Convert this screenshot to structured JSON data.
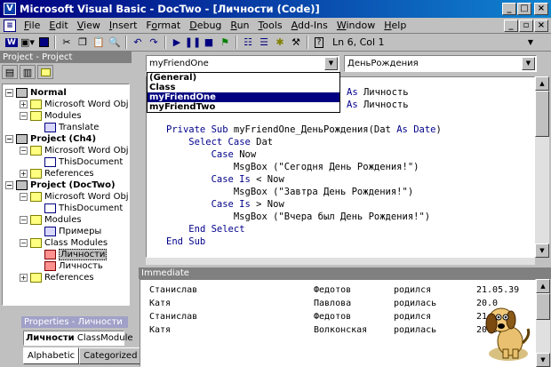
{
  "window": {
    "title": "Microsoft Visual Basic - DocTwo - [Личности (Code)]",
    "app_icon": "vb-icon"
  },
  "menubar": {
    "items": [
      "File",
      "Edit",
      "View",
      "Insert",
      "Format",
      "Debug",
      "Run",
      "Tools",
      "Add-Ins",
      "Window",
      "Help"
    ],
    "accelerators": [
      "F",
      "E",
      "V",
      "I",
      "o",
      "D",
      "R",
      "T",
      "A",
      "W",
      "H"
    ]
  },
  "toolbar": {
    "position": "Ln 6, Col 1",
    "icons": [
      "word-icon",
      "insert-module-icon",
      "save-icon",
      "cut-icon",
      "copy-icon",
      "paste-icon",
      "find-icon",
      "undo-icon",
      "redo-icon",
      "run-icon",
      "break-icon",
      "reset-icon",
      "design-mode-icon",
      "project-explorer-icon",
      "properties-icon",
      "object-browser-icon",
      "toolbox-icon",
      "help-icon"
    ]
  },
  "project_panel": {
    "title": "Project - Project",
    "tree": [
      {
        "label": "Normal",
        "bold": true,
        "level": 0,
        "expander": "−",
        "icon": "project-icon"
      },
      {
        "label": "Microsoft Word Objects",
        "level": 1,
        "expander": "+",
        "icon": "folder-icon"
      },
      {
        "label": "Modules",
        "level": 1,
        "expander": "−",
        "icon": "folder-icon"
      },
      {
        "label": "Translate",
        "level": 2,
        "icon": "module-icon"
      },
      {
        "label": "Project (Ch4)",
        "bold": true,
        "level": 0,
        "expander": "−",
        "icon": "project-icon"
      },
      {
        "label": "Microsoft Word Objects",
        "level": 1,
        "expander": "−",
        "icon": "folder-icon"
      },
      {
        "label": "ThisDocument",
        "level": 2,
        "icon": "document-icon"
      },
      {
        "label": "References",
        "level": 1,
        "expander": "+",
        "icon": "folder-icon"
      },
      {
        "label": "Project (DocTwo)",
        "bold": true,
        "level": 0,
        "expander": "−",
        "icon": "project-icon"
      },
      {
        "label": "Microsoft Word Objects",
        "level": 1,
        "expander": "−",
        "icon": "folder-icon"
      },
      {
        "label": "ThisDocument",
        "level": 2,
        "icon": "document-icon"
      },
      {
        "label": "Modules",
        "level": 1,
        "expander": "−",
        "icon": "folder-icon"
      },
      {
        "label": "Примеры",
        "level": 2,
        "icon": "module-icon"
      },
      {
        "label": "Class Modules",
        "level": 1,
        "expander": "−",
        "icon": "folder-icon"
      },
      {
        "label": "Личности",
        "level": 2,
        "icon": "class-module-icon",
        "selected": true
      },
      {
        "label": "Личность",
        "level": 2,
        "icon": "class-module-icon"
      },
      {
        "label": "References",
        "level": 1,
        "expander": "+",
        "icon": "folder-icon"
      }
    ]
  },
  "properties_panel": {
    "title": "Properties - Личности",
    "object_name": "Личности",
    "object_type": "ClassModule",
    "tabs": [
      "Alphabetic",
      "Categorized"
    ]
  },
  "code_window": {
    "object_combo": "myFriendOne",
    "procedure_combo": "ДеньРождения",
    "object_dropdown": [
      "(General)",
      "Class",
      "myFriendOne",
      "myFriendTwo"
    ],
    "selected_dropdown_index": 2,
    "lines": [
      [
        {
          "t": "",
          "k": false
        },
        {
          "t": "As",
          "k": true
        },
        {
          "t": " Личность",
          "k": false
        }
      ],
      [
        {
          "t": "",
          "k": false
        },
        {
          "t": "As",
          "k": true
        },
        {
          "t": " Личность",
          "k": false
        }
      ],
      [
        {
          "t": "",
          "k": false
        }
      ],
      [
        {
          "t": "Private Sub",
          "k": true
        },
        {
          "t": " myFriendOne_ДеньРождения(Dat ",
          "k": false
        },
        {
          "t": "As",
          "k": true
        },
        {
          "t": " ",
          "k": false
        },
        {
          "t": "Date",
          "k": true
        },
        {
          "t": ")",
          "k": false
        }
      ],
      [
        {
          "t": "    ",
          "k": false
        },
        {
          "t": "Select Case",
          "k": true
        },
        {
          "t": " Dat",
          "k": false
        }
      ],
      [
        {
          "t": "        ",
          "k": false
        },
        {
          "t": "Case",
          "k": true
        },
        {
          "t": " Now",
          "k": false
        }
      ],
      [
        {
          "t": "            MsgBox (\"Сегодня День Рождения!\")",
          "k": false
        }
      ],
      [
        {
          "t": "        ",
          "k": false
        },
        {
          "t": "Case Is",
          "k": true
        },
        {
          "t": " < Now",
          "k": false
        }
      ],
      [
        {
          "t": "            MsgBox (\"Завтра День Рождения!\")",
          "k": false
        }
      ],
      [
        {
          "t": "        ",
          "k": false
        },
        {
          "t": "Case Is",
          "k": true
        },
        {
          "t": " > Now",
          "k": false
        }
      ],
      [
        {
          "t": "            MsgBox (\"Вчера был День Рождения!\")",
          "k": false
        }
      ],
      [
        {
          "t": "    ",
          "k": false
        },
        {
          "t": "End Select",
          "k": true
        }
      ],
      [
        {
          "t": "End Sub",
          "k": true
        }
      ]
    ]
  },
  "immediate_window": {
    "title": "Immediate",
    "rows": [
      [
        "Станислав",
        "Федотов",
        "родился",
        "21.05.39"
      ],
      [
        "Катя",
        "Павлова",
        "родилась",
        "20.0"
      ],
      [
        "Станислав",
        "Федотов",
        "родился",
        "21."
      ],
      [
        "Катя",
        "Волконская",
        "родилась",
        "20.03"
      ]
    ]
  },
  "assistant": {
    "name": "office-assistant-dog"
  },
  "colors": {
    "title_bar": "#000080",
    "keyword": "#00008b",
    "selection": "#000080",
    "chrome": "#c0c0c0"
  }
}
